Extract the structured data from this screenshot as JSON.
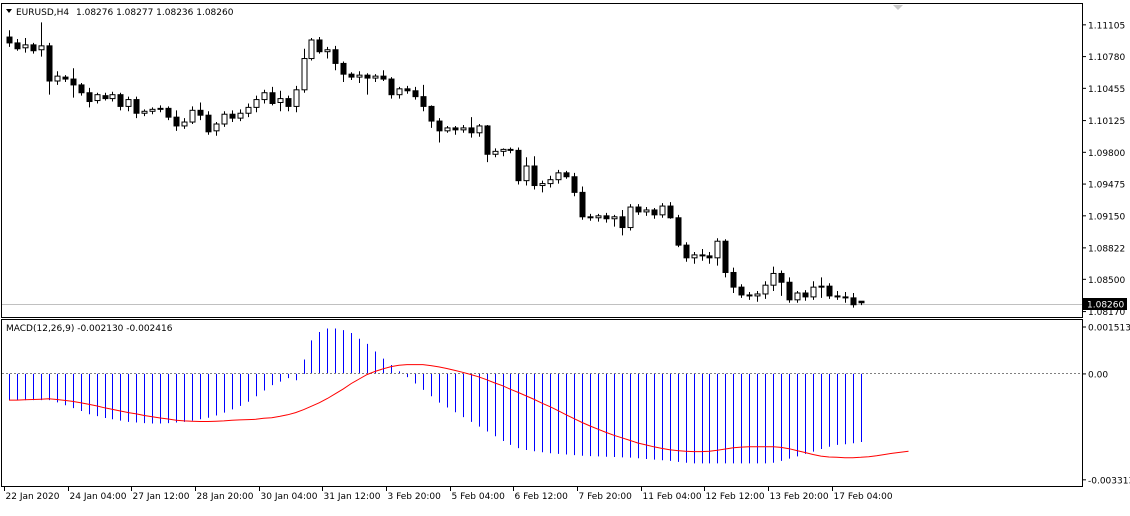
{
  "price_header": {
    "symbol": "EURUSD,H4",
    "ohlc_text": "1.08276 1.08277 1.08236 1.08260",
    "current_price": "1.08260"
  },
  "macd_header": {
    "label": "MACD(12,26,9) -0.002130 -0.002416"
  },
  "colors": {
    "histogram": "#0000ff",
    "signal": "#ff0000",
    "candle": "#000000",
    "zero_line": "#808080"
  },
  "chart_data": [
    {
      "type": "candlestick",
      "title": "EURUSD,H4",
      "ylim": [
        1.08145,
        1.11175
      ],
      "y_ticks": [
        "1.11105",
        "1.10780",
        "1.10455",
        "1.10125",
        "1.09800",
        "1.09475",
        "1.09150",
        "1.08822",
        "1.08500",
        "1.08170"
      ],
      "y_tick_values": [
        1.11105,
        1.1078,
        1.10455,
        1.10125,
        1.098,
        1.09475,
        1.0915,
        1.08822,
        1.085,
        1.0817
      ],
      "current_price": 1.0826,
      "x_ticks": [
        "22 Jan 2020",
        "24 Jan 04:00",
        "27 Jan 12:00",
        "28 Jan 20:00",
        "30 Jan 04:00",
        "31 Jan 12:00",
        "3 Feb 20:00",
        "5 Feb 04:00",
        "6 Feb 12:00",
        "7 Feb 20:00",
        "11 Feb 04:00",
        "12 Feb 12:00",
        "13 Feb 20:00",
        "17 Feb 04:00"
      ],
      "x_tick_bars": [
        0,
        8,
        16,
        24,
        32,
        40,
        48,
        56,
        64,
        72,
        80,
        88,
        96,
        104
      ],
      "candles": [
        [
          1.1098,
          1.1105,
          1.1088,
          1.1092
        ],
        [
          1.1092,
          1.1096,
          1.1084,
          1.1086
        ],
        [
          1.1087,
          1.1097,
          1.1082,
          1.109
        ],
        [
          1.109,
          1.1092,
          1.1081,
          1.1084
        ],
        [
          1.1085,
          1.1113,
          1.1078,
          1.1089
        ],
        [
          1.1089,
          1.1092,
          1.1039,
          1.1053
        ],
        [
          1.1053,
          1.1063,
          1.1049,
          1.1058
        ],
        [
          1.1057,
          1.1059,
          1.1052,
          1.1055
        ],
        [
          1.1055,
          1.1066,
          1.1036,
          1.1049
        ],
        [
          1.1049,
          1.1051,
          1.1038,
          1.1041
        ],
        [
          1.1041,
          1.1046,
          1.1026,
          1.1032
        ],
        [
          1.1033,
          1.1041,
          1.103,
          1.1039
        ],
        [
          1.1038,
          1.1041,
          1.1033,
          1.1035
        ],
        [
          1.1035,
          1.1042,
          1.1032,
          1.1039
        ],
        [
          1.1039,
          1.1041,
          1.1023,
          1.1027
        ],
        [
          1.1027,
          1.1037,
          1.1022,
          1.1034
        ],
        [
          1.1034,
          1.1037,
          1.1015,
          1.102
        ],
        [
          1.102,
          1.1024,
          1.1017,
          1.1022
        ],
        [
          1.1022,
          1.1026,
          1.1019,
          1.1024
        ],
        [
          1.1024,
          1.1028,
          1.1021,
          1.1025
        ],
        [
          1.1025,
          1.1027,
          1.1013,
          1.1016
        ],
        [
          1.1016,
          1.1023,
          1.1002,
          1.1007
        ],
        [
          1.1007,
          1.1015,
          1.1004,
          1.1011
        ],
        [
          1.1011,
          1.1027,
          1.1009,
          1.1023
        ],
        [
          1.1023,
          1.1031,
          1.1013,
          1.1018
        ],
        [
          1.1018,
          1.1022,
          1.0998,
          1.1001
        ],
        [
          1.1002,
          1.1011,
          1.0997,
          1.1009
        ],
        [
          1.1009,
          1.1022,
          1.1006,
          1.1019
        ],
        [
          1.1019,
          1.1023,
          1.1011,
          1.1015
        ],
        [
          1.1015,
          1.1024,
          1.1012,
          1.102
        ],
        [
          1.102,
          1.103,
          1.1016,
          1.1026
        ],
        [
          1.1026,
          1.1038,
          1.1021,
          1.1034
        ],
        [
          1.1034,
          1.1044,
          1.103,
          1.1041
        ],
        [
          1.1041,
          1.1047,
          1.1028,
          1.103
        ],
        [
          1.1031,
          1.1043,
          1.1022,
          1.1035
        ],
        [
          1.1035,
          1.1038,
          1.1022,
          1.1027
        ],
        [
          1.1027,
          1.1048,
          1.1021,
          1.1044
        ],
        [
          1.1044,
          1.1086,
          1.1041,
          1.1076
        ],
        [
          1.1076,
          1.1097,
          1.1074,
          1.1095
        ],
        [
          1.1095,
          1.1098,
          1.1081,
          1.1083
        ],
        [
          1.1083,
          1.1088,
          1.1076,
          1.1085
        ],
        [
          1.1085,
          1.1089,
          1.1064,
          1.1071
        ],
        [
          1.1071,
          1.1073,
          1.1052,
          1.106
        ],
        [
          1.106,
          1.1062,
          1.1054,
          1.1057
        ],
        [
          1.1057,
          1.1063,
          1.1051,
          1.1059
        ],
        [
          1.1059,
          1.1061,
          1.1039,
          1.1056
        ],
        [
          1.1056,
          1.106,
          1.1052,
          1.1058
        ],
        [
          1.1058,
          1.1064,
          1.1053,
          1.1055
        ],
        [
          1.1055,
          1.1057,
          1.1035,
          1.1039
        ],
        [
          1.1039,
          1.1047,
          1.1035,
          1.1045
        ],
        [
          1.1045,
          1.1048,
          1.104,
          1.1043
        ],
        [
          1.1043,
          1.1047,
          1.1034,
          1.1037
        ],
        [
          1.1037,
          1.1049,
          1.1022,
          1.1027
        ],
        [
          1.1027,
          1.1028,
          1.1005,
          1.1012
        ],
        [
          1.1012,
          1.1015,
          1.099,
          1.1002
        ],
        [
          1.1002,
          1.1007,
          1.1,
          1.1005
        ],
        [
          1.1005,
          1.1007,
          1.0998,
          1.1003
        ],
        [
          1.1003,
          1.1008,
          1.1,
          1.1005
        ],
        [
          1.1005,
          1.1016,
          1.0995,
          1.1
        ],
        [
          1.1,
          1.1009,
          1.0996,
          1.1007
        ],
        [
          1.1007,
          1.1008,
          1.097,
          1.0978
        ],
        [
          1.0978,
          1.0984,
          1.0975,
          1.0981
        ],
        [
          1.0981,
          1.0984,
          1.0976,
          1.0983
        ],
        [
          1.0983,
          1.0985,
          1.0979,
          1.0982
        ],
        [
          1.0982,
          1.0985,
          1.0947,
          1.0951
        ],
        [
          1.0951,
          1.0975,
          1.0946,
          1.0966
        ],
        [
          1.0966,
          1.0976,
          1.0942,
          1.0946
        ],
        [
          1.0946,
          1.0951,
          1.0939,
          1.0948
        ],
        [
          1.0948,
          1.0956,
          1.0944,
          1.0952
        ],
        [
          1.0952,
          1.0962,
          1.0948,
          1.0959
        ],
        [
          1.0959,
          1.0961,
          1.0953,
          1.0955
        ],
        [
          1.0955,
          1.0959,
          1.0935,
          1.0939
        ],
        [
          1.0939,
          1.0945,
          1.0911,
          1.0914
        ],
        [
          1.0914,
          1.0917,
          1.091,
          1.0913
        ],
        [
          1.0913,
          1.0917,
          1.0909,
          1.0915
        ],
        [
          1.0915,
          1.0918,
          1.0908,
          1.0912
        ],
        [
          1.0912,
          1.0916,
          1.0904,
          1.0914
        ],
        [
          1.0914,
          1.0921,
          1.0895,
          1.0903
        ],
        [
          1.0903,
          1.0927,
          1.09,
          1.0924
        ],
        [
          1.0924,
          1.0927,
          1.0916,
          1.0919
        ],
        [
          1.0919,
          1.0924,
          1.0915,
          1.0921
        ],
        [
          1.0921,
          1.0923,
          1.0912,
          1.0916
        ],
        [
          1.0916,
          1.0928,
          1.0913,
          1.0925
        ],
        [
          1.0925,
          1.0929,
          1.0912,
          1.0913
        ],
        [
          1.0913,
          1.0916,
          1.0883,
          1.0885
        ],
        [
          1.0885,
          1.0888,
          1.0868,
          1.0872
        ],
        [
          1.0872,
          1.0878,
          1.0866,
          1.0875
        ],
        [
          1.0875,
          1.0881,
          1.0869,
          1.0874
        ],
        [
          1.0874,
          1.0878,
          1.0866,
          1.0872
        ],
        [
          1.0872,
          1.0892,
          1.0864,
          1.0889
        ],
        [
          1.0889,
          1.0891,
          1.0852,
          1.0857
        ],
        [
          1.0857,
          1.0862,
          1.0836,
          1.0842
        ],
        [
          1.0842,
          1.0845,
          1.0831,
          1.0834
        ],
        [
          1.0834,
          1.0837,
          1.0829,
          1.0833
        ],
        [
          1.0833,
          1.0838,
          1.0827,
          1.0835
        ],
        [
          1.0835,
          1.0848,
          1.083,
          1.0844
        ],
        [
          1.0844,
          1.0863,
          1.0838,
          1.0856
        ],
        [
          1.0856,
          1.0859,
          1.0833,
          1.0847
        ],
        [
          1.0847,
          1.0852,
          1.0826,
          1.0829
        ],
        [
          1.0829,
          1.0838,
          1.0826,
          1.0836
        ],
        [
          1.0836,
          1.0839,
          1.0828,
          1.0832
        ],
        [
          1.0832,
          1.0848,
          1.0829,
          1.0842
        ],
        [
          1.0842,
          1.0852,
          1.0831,
          1.0843
        ],
        [
          1.0843,
          1.0846,
          1.083,
          1.0833
        ],
        [
          1.0833,
          1.0838,
          1.0829,
          1.0832
        ],
        [
          1.0832,
          1.0837,
          1.0826,
          1.0831
        ],
        [
          1.0831,
          1.0836,
          1.0821,
          1.0824
        ],
        [
          1.08276,
          1.08277,
          1.08236,
          1.0826
        ]
      ]
    },
    {
      "type": "bar+line",
      "title": "MACD(12,26,9) -0.002130 -0.002416",
      "ylim": [
        -0.00335,
        0.00153
      ],
      "y_ticks": [
        "0.001513",
        "0.00",
        "-0.003313"
      ],
      "y_tick_values": [
        0.001513,
        0,
        -0.003313
      ],
      "series": [
        {
          "name": "MACD",
          "type": "bar",
          "values": [
            -0.00082,
            -0.00082,
            -0.00082,
            -0.00082,
            -0.00082,
            -0.00082,
            -0.00089,
            -0.00098,
            -0.00107,
            -0.00116,
            -0.00126,
            -0.00132,
            -0.00138,
            -0.00142,
            -0.00146,
            -0.0015,
            -0.00152,
            -0.00154,
            -0.00155,
            -0.00155,
            -0.00154,
            -0.00152,
            -0.0015,
            -0.00146,
            -0.00142,
            -0.00137,
            -0.0013,
            -0.00121,
            -0.00111,
            -0.001,
            -0.00087,
            -0.0007,
            -0.00052,
            -0.00035,
            -0.00024,
            -0.00013,
            -0.0002,
            0.00045,
            0.00105,
            0.00131,
            0.00142,
            0.00142,
            0.00137,
            0.00128,
            0.0011,
            0.00094,
            0.0007,
            0.00048,
            0.00028,
            8e-05,
            -0.0001,
            -0.0003,
            -0.0005,
            -0.0007,
            -0.0009,
            -0.00105,
            -0.0012,
            -0.00135,
            -0.0015,
            -0.00165,
            -0.0018,
            -0.00195,
            -0.0021,
            -0.00222,
            -0.00232,
            -0.00238,
            -0.00242,
            -0.00245,
            -0.00248,
            -0.0025,
            -0.00252,
            -0.00254,
            -0.00256,
            -0.00257,
            -0.00258,
            -0.00259,
            -0.0026,
            -0.00261,
            -0.00262,
            -0.00264,
            -0.00266,
            -0.00268,
            -0.0027,
            -0.00272,
            -0.00275,
            -0.00278,
            -0.0028,
            -0.0028,
            -0.0028,
            -0.0028,
            -0.0028,
            -0.0028,
            -0.0028,
            -0.0028,
            -0.0028,
            -0.0028,
            -0.00278,
            -0.00272,
            -0.00265,
            -0.00258,
            -0.0025,
            -0.00243,
            -0.00235,
            -0.00228,
            -0.00222,
            -0.0022,
            -0.00217,
            -0.00213
          ]
        },
        {
          "name": "Signal",
          "type": "line",
          "values": [
            -0.00082,
            -0.00082,
            -0.00081,
            -0.0008,
            -0.00079,
            -0.00078,
            -0.0008,
            -0.00083,
            -0.00086,
            -0.0009,
            -0.00095,
            -0.001,
            -0.00106,
            -0.00111,
            -0.00116,
            -0.00121,
            -0.00125,
            -0.0013,
            -0.00134,
            -0.00138,
            -0.00141,
            -0.00145,
            -0.00147,
            -0.00148,
            -0.00149,
            -0.00149,
            -0.00148,
            -0.00147,
            -0.00145,
            -0.00144,
            -0.00143,
            -0.00142,
            -0.00139,
            -0.00137,
            -0.00133,
            -0.00128,
            -0.00121,
            -0.00112,
            -0.00101,
            -0.0009,
            -0.00077,
            -0.00062,
            -0.00047,
            -0.0003,
            -0.00016,
            -2e-05,
            8e-05,
            0.00016,
            0.00023,
            0.00027,
            0.00029,
            0.00029,
            0.00029,
            0.00026,
            0.00022,
            0.00017,
            0.00011,
            5e-05,
            -2e-05,
            -9e-05,
            -0.00018,
            -0.00028,
            -0.00037,
            -0.00048,
            -0.00058,
            -0.00069,
            -0.0008,
            -0.00092,
            -0.00103,
            -0.00115,
            -0.00128,
            -0.0014,
            -0.00152,
            -0.00163,
            -0.00173,
            -0.00183,
            -0.00192,
            -0.002,
            -0.00208,
            -0.00216,
            -0.00222,
            -0.00228,
            -0.00233,
            -0.00237,
            -0.0024,
            -0.00242,
            -0.00243,
            -0.00243,
            -0.00242,
            -0.00239,
            -0.00235,
            -0.00231,
            -0.00229,
            -0.00228,
            -0.00228,
            -0.00228,
            -0.00228,
            -0.0023,
            -0.00234,
            -0.0024,
            -0.00246,
            -0.00252,
            -0.00257,
            -0.0026,
            -0.00261,
            -0.00262,
            -0.00262,
            -0.00261,
            -0.00259,
            -0.00256,
            -0.00252,
            -0.00248,
            -0.00245,
            -0.00242
          ]
        }
      ]
    }
  ]
}
